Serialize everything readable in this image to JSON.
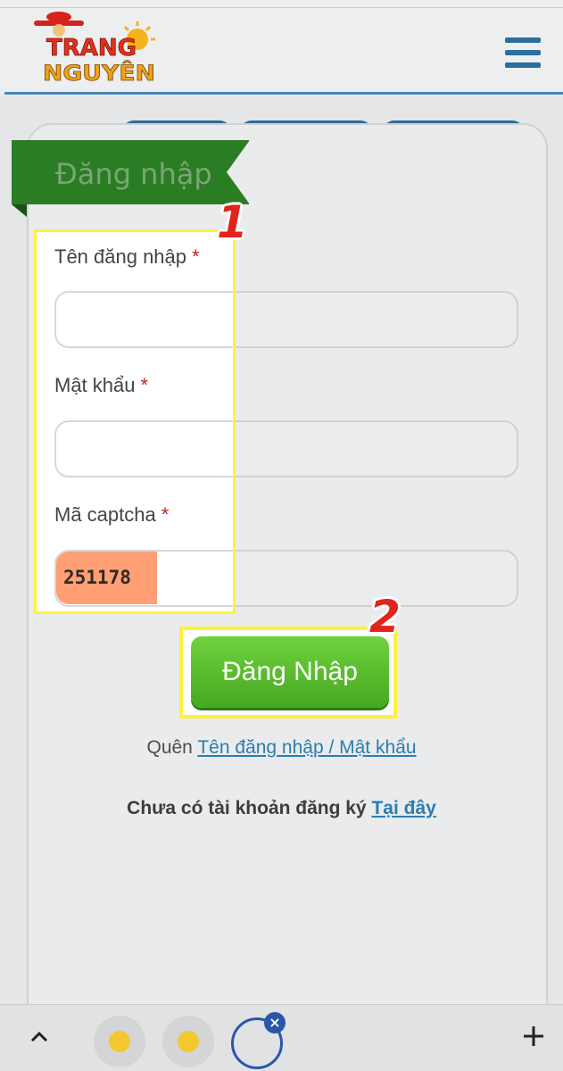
{
  "header": {
    "logo_text_line1": "TRANG",
    "logo_text_line2": "NGUYÊN",
    "menu_icon": "hamburger-icon"
  },
  "login_card": {
    "title": "Đăng nhập",
    "username_label": "Tên đăng nhập",
    "password_label": "Mật khẩu",
    "captcha_label": "Mã captcha",
    "required_mark": "*",
    "username_value": "",
    "password_value": "",
    "captcha_code": "251178",
    "captcha_input_value": "",
    "login_button": "Đăng Nhập",
    "forgot_prefix": "Quên",
    "forgot_link": "Tên đăng nhập / Mật khẩu",
    "register_prefix": "Chưa có tài khoản đăng ký",
    "register_link": "Tại đây"
  },
  "annotations": {
    "step_1": "1",
    "step_2": "2",
    "highlight_color": "#fff13a",
    "step_color": "#e3221b"
  },
  "bottom_bar": {
    "icons": [
      "chevron-up-icon",
      "tab-icon",
      "tab-icon",
      "active-tab-icon",
      "close-icon",
      "plus-icon"
    ],
    "close_glyph": "×"
  },
  "colors": {
    "ribbon": "#2b7d24",
    "button": "#56bb2a",
    "link": "#2c7daf",
    "header_line": "#4a87b8",
    "captcha_bg": "#ff9f73"
  }
}
